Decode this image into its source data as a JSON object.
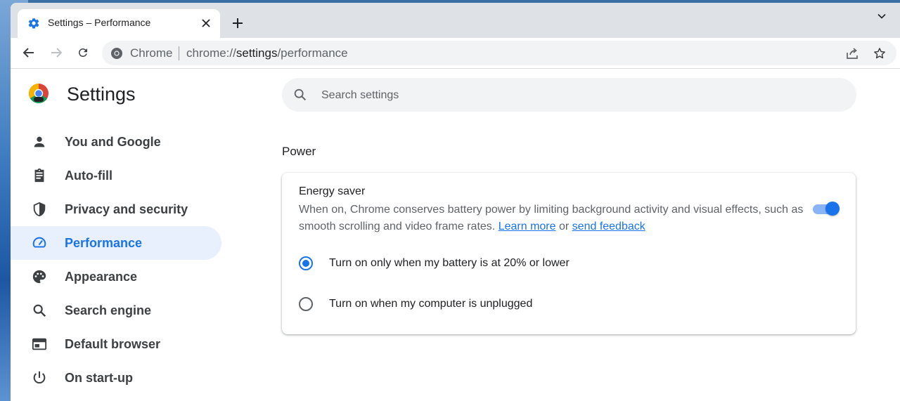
{
  "tab": {
    "title": "Settings – Performance"
  },
  "omnibox": {
    "chip": "Chrome",
    "url_scheme": "chrome://",
    "url_host": "settings",
    "url_path": "/performance"
  },
  "settings": {
    "title": "Settings"
  },
  "sidebar": {
    "items": [
      {
        "label": "You and Google",
        "icon": "person-icon",
        "active": false
      },
      {
        "label": "Auto-fill",
        "icon": "clipboard-icon",
        "active": false
      },
      {
        "label": "Privacy and security",
        "icon": "shield-icon",
        "active": false
      },
      {
        "label": "Performance",
        "icon": "speedometer-icon",
        "active": true
      },
      {
        "label": "Appearance",
        "icon": "palette-icon",
        "active": false
      },
      {
        "label": "Search engine",
        "icon": "search-icon",
        "active": false
      },
      {
        "label": "Default browser",
        "icon": "browser-icon",
        "active": false
      },
      {
        "label": "On start-up",
        "icon": "power-icon",
        "active": false
      }
    ]
  },
  "search": {
    "placeholder": "Search settings"
  },
  "main": {
    "section_title": "Power",
    "energy_saver": {
      "title": "Energy saver",
      "description": "When on, Chrome conserves battery power by limiting background activity and visual effects, such as smooth scrolling and video frame rates.",
      "learn_more": "Learn more",
      "or": "or",
      "send_feedback": "send feedback",
      "enabled": true,
      "options": [
        {
          "label": "Turn on only when my battery is at 20% or lower",
          "checked": true
        },
        {
          "label": "Turn on when my computer is unplugged",
          "checked": false
        }
      ]
    }
  },
  "colors": {
    "accent": "#1a73e8",
    "active_nav_bg": "#e8f0fe",
    "tabstrip_bg": "#dee1e6"
  }
}
